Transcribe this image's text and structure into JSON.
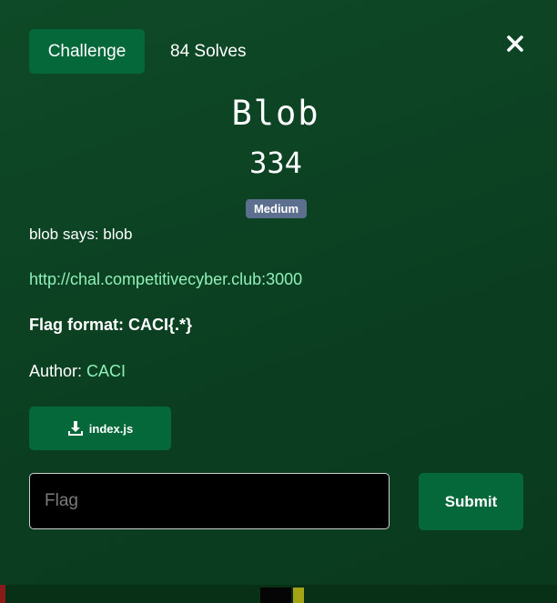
{
  "header": {
    "tab_label": "Challenge",
    "solves": "84 Solves",
    "close_icon": "close-icon"
  },
  "challenge": {
    "name": "Blob",
    "points": "334",
    "difficulty": "Medium",
    "description": "blob says: blob",
    "url": "http://chal.competitivecyber.club:3000",
    "flag_format": "Flag format: CACI{.*}",
    "author_label": "Author: ",
    "author_name": "CACI"
  },
  "files": [
    {
      "label": "index.js",
      "icon": "download-icon"
    }
  ],
  "submission": {
    "placeholder": "Flag",
    "submit_label": "Submit"
  },
  "colors": {
    "background": "#0b3f21",
    "button": "#05683a",
    "badge": "#5d6f8f",
    "link": "#8ff0b8"
  }
}
